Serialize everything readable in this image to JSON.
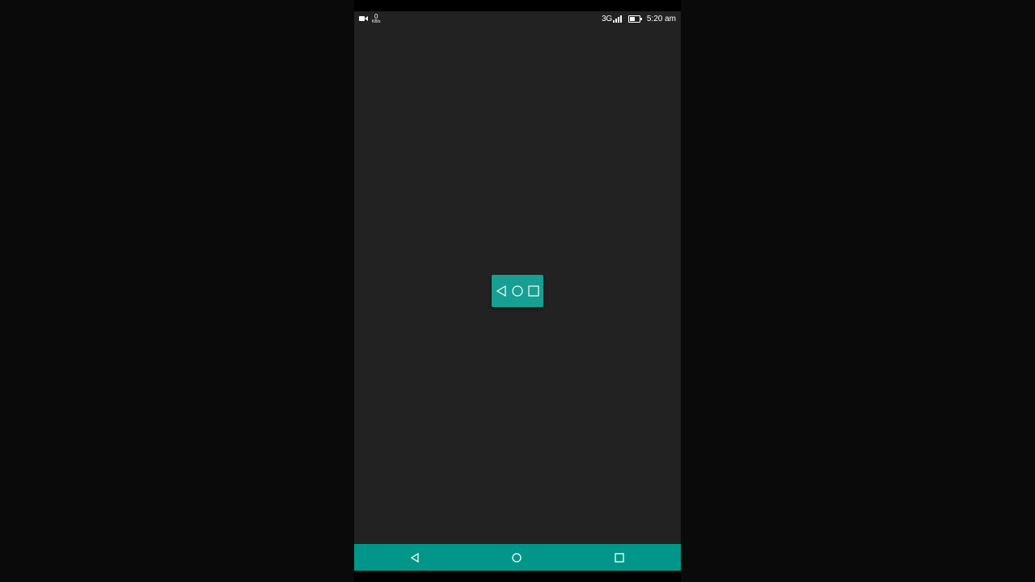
{
  "status_bar": {
    "net_speed_value": "0",
    "net_speed_unit": "KB/s",
    "network_type": "3G",
    "time": "5:20 am",
    "icons": [
      "video-camera-icon",
      "signal-icon",
      "battery-icon"
    ]
  },
  "floating_nav": {
    "buttons": [
      "back-icon",
      "home-icon",
      "recents-icon"
    ]
  },
  "nav_bar": {
    "buttons": [
      "back-icon",
      "home-icon",
      "recents-icon"
    ]
  },
  "colors": {
    "screen_background": "#222222",
    "nav_bar": "#00978a",
    "floating_nav": "#169f92"
  }
}
